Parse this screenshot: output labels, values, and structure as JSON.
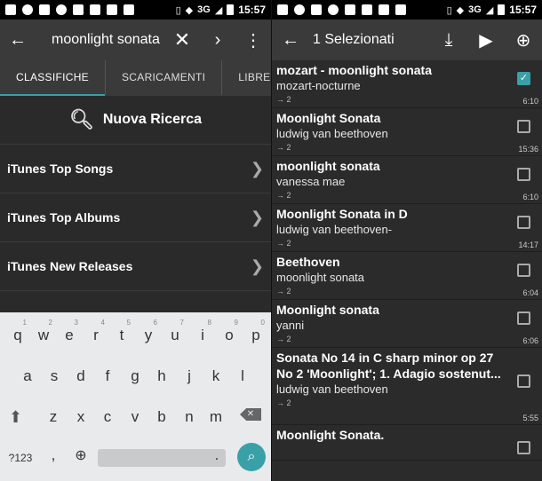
{
  "status": {
    "net_left": "3G",
    "time_left": "15:57",
    "net_right": "3G",
    "time_right": "15:57"
  },
  "search": {
    "query": "moonlight sonata",
    "tabs": [
      "CLASSIFICHE",
      "SCARICAMENTI",
      "LIBRERIA"
    ],
    "new_search_label": "Nuova Ricerca",
    "rows": [
      "iTunes Top Songs",
      "iTunes Top Albums",
      "iTunes New Releases"
    ]
  },
  "keyboard": {
    "row1": [
      {
        "k": "q",
        "h": "1"
      },
      {
        "k": "w",
        "h": "2"
      },
      {
        "k": "e",
        "h": "3"
      },
      {
        "k": "r",
        "h": "4"
      },
      {
        "k": "t",
        "h": "5"
      },
      {
        "k": "y",
        "h": "6"
      },
      {
        "k": "u",
        "h": "7"
      },
      {
        "k": "i",
        "h": "8"
      },
      {
        "k": "o",
        "h": "9"
      },
      {
        "k": "p",
        "h": "0"
      }
    ],
    "row2": [
      "a",
      "s",
      "d",
      "f",
      "g",
      "h",
      "j",
      "k",
      "l"
    ],
    "row3": [
      "z",
      "x",
      "c",
      "v",
      "b",
      "n",
      "m"
    ],
    "symbols_label": "?123",
    "comma": ",",
    "period": "."
  },
  "selection": {
    "title": "1 Selezionati",
    "items": [
      {
        "title": "mozart - moonlight sonata",
        "artist": "mozart-nocturne",
        "count": "→ 2",
        "duration": "6:10",
        "checked": true
      },
      {
        "title": "Moonlight Sonata",
        "artist": "ludwig van beethoven",
        "count": "→ 2",
        "duration": "15:36",
        "checked": false
      },
      {
        "title": "moonlight sonata",
        "artist": "vanessa mae",
        "count": "→ 2",
        "duration": "6:10",
        "checked": false
      },
      {
        "title": "Moonlight Sonata in D",
        "artist": "ludwig van beethoven-",
        "count": "→ 2",
        "duration": "14:17",
        "checked": false
      },
      {
        "title": "Beethoven",
        "artist": "moonlight sonata",
        "count": "→ 2",
        "duration": "6:04",
        "checked": false
      },
      {
        "title": "Moonlight sonata",
        "artist": "yanni",
        "count": "→ 2",
        "duration": "6:06",
        "checked": false
      },
      {
        "title": "Sonata No 14 in C sharp minor op 27 No 2 'Moonlight'; 1. Adagio sostenut...",
        "artist": "ludwig van beethoven",
        "count": "→ 2",
        "duration": "5:55",
        "checked": false
      },
      {
        "title": "Moonlight Sonata.",
        "artist": "",
        "count": "",
        "duration": "",
        "checked": false
      }
    ]
  },
  "colors": {
    "accent": "#3aa0a8",
    "toolbar": "#3a3a3a",
    "background": "#2a2a2a"
  }
}
